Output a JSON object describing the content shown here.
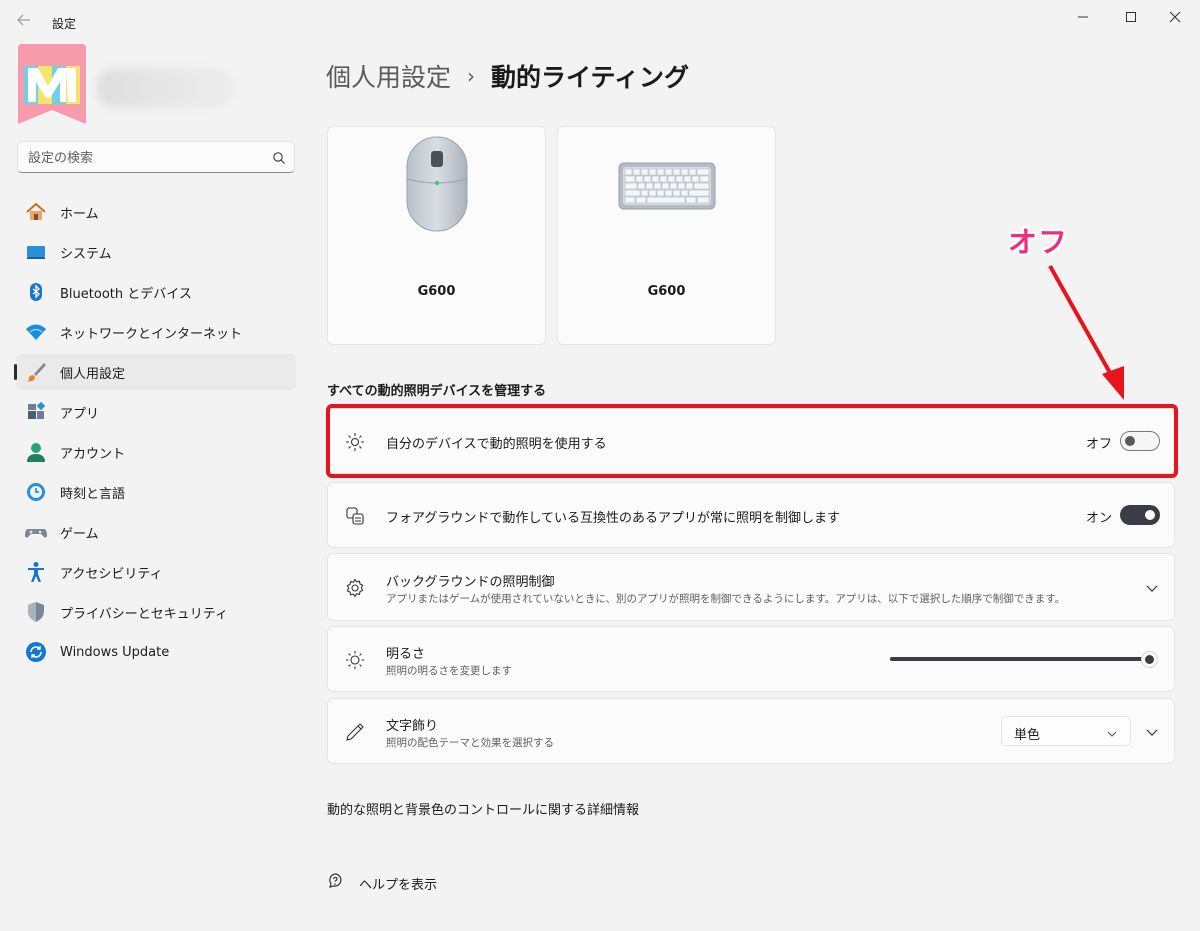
{
  "window": {
    "title": "設定",
    "back_icon": "back-arrow-icon",
    "controls": [
      "minimize",
      "maximize",
      "close"
    ]
  },
  "sidebar": {
    "search_placeholder": "設定の検索",
    "items": [
      {
        "label": "ホーム",
        "icon": "home-icon",
        "active": false
      },
      {
        "label": "システム",
        "icon": "system-icon",
        "active": false
      },
      {
        "label": "Bluetooth とデバイス",
        "icon": "bluetooth-icon",
        "active": false
      },
      {
        "label": "ネットワークとインターネット",
        "icon": "wifi-icon",
        "active": false
      },
      {
        "label": "個人用設定",
        "icon": "brush-icon",
        "active": true
      },
      {
        "label": "アプリ",
        "icon": "apps-icon",
        "active": false
      },
      {
        "label": "アカウント",
        "icon": "account-icon",
        "active": false
      },
      {
        "label": "時刻と言語",
        "icon": "time-language-icon",
        "active": false
      },
      {
        "label": "ゲーム",
        "icon": "gamepad-icon",
        "active": false
      },
      {
        "label": "アクセシビリティ",
        "icon": "accessibility-icon",
        "active": false
      },
      {
        "label": "プライバシーとセキュリティ",
        "icon": "shield-icon",
        "active": false
      },
      {
        "label": "Windows Update",
        "icon": "update-icon",
        "active": false
      }
    ]
  },
  "breadcrumb": {
    "parent": "個人用設定",
    "separator": "›",
    "current": "動的ライティング"
  },
  "devices": [
    {
      "name": "G600",
      "icon": "mouse-icon"
    },
    {
      "name": "G600",
      "icon": "keyboard-icon"
    }
  ],
  "section_title": "すべての動的照明デバイスを管理する",
  "settings": {
    "use_lighting": {
      "title": "自分のデバイスで動的照明を使用する",
      "state_label": "オフ",
      "on": false
    },
    "foreground": {
      "title": "フォアグラウンドで動作している互換性のあるアプリが常に照明を制御します",
      "state_label": "オン",
      "on": true
    },
    "background": {
      "title": "バックグラウンドの照明制御",
      "subtitle": "アプリまたはゲームが使用されていないときに、別のアプリが照明を制御できるようにします。アプリは、以下で選択した順序で制御できます。"
    },
    "brightness": {
      "title": "明るさ",
      "subtitle": "照明の明るさを変更します",
      "value_fraction": 1.0
    },
    "effects": {
      "title": "文字飾り",
      "subtitle": "照明の配色テーマと効果を選択する",
      "selected": "単色"
    }
  },
  "link_info": "動的な照明と背景色のコントロールに関する詳細情報",
  "help_label": "ヘルプを表示",
  "annotation": {
    "label": "オフ",
    "color": "#ef2d7e",
    "box_color": "#e8141c"
  },
  "colors": {
    "accent_toggle": "#3a3e44",
    "background": "#f3f3f3"
  }
}
